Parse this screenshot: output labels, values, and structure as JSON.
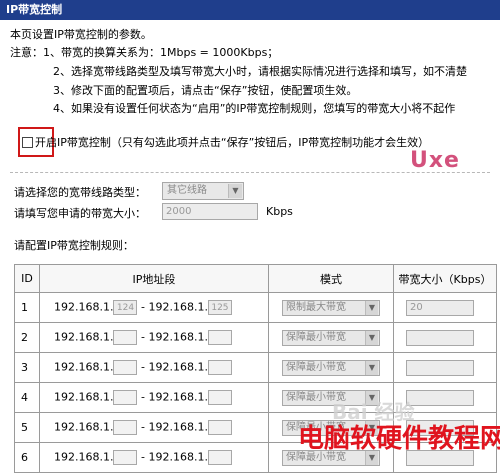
{
  "header": {
    "title": "IP带宽控制"
  },
  "intro": "本页设置IP带宽控制的参数。",
  "notes": [
    "注意：1、带宽的换算关系为：1Mbps = 1000Kbps；",
    "2、选择宽带线路类型及填写带宽大小时，请根据实际情况进行选择和填写，如不清楚",
    "3、修改下面的配置项后，请点击“保存”按钮，使配置项生效。",
    "4、如果没有设置任何状态为“启用”的IP带宽控制规则，您填写的带宽大小将不起作"
  ],
  "enable": {
    "label": "开启IP带宽控制（只有勾选此项并点击“保存”按钮后，IP带宽控制功能才会生效）",
    "checked": false
  },
  "watermark_top": "Uxe",
  "form": {
    "line_type_label": "请选择您的宽带线路类型：",
    "line_type_value": "其它线路",
    "bandwidth_label": "请填写您申请的带宽大小：",
    "bandwidth_value": "2000",
    "bandwidth_unit": "Kbps"
  },
  "rules_title": "请配置IP带宽控制规则：",
  "table": {
    "headers": {
      "id": "ID",
      "ip": "IP地址段",
      "mode": "模式",
      "bandwidth": "带宽大小（Kbps）"
    },
    "ip_prefix": "192.168.1.",
    "ip_sep": "-",
    "rows": [
      {
        "id": "1",
        "start": "124",
        "end": "125",
        "mode": "限制最大带宽",
        "bw": "20"
      },
      {
        "id": "2",
        "start": "",
        "end": "",
        "mode": "保障最小带宽",
        "bw": ""
      },
      {
        "id": "3",
        "start": "",
        "end": "",
        "mode": "保障最小带宽",
        "bw": ""
      },
      {
        "id": "4",
        "start": "",
        "end": "",
        "mode": "保障最小带宽",
        "bw": ""
      },
      {
        "id": "5",
        "start": "",
        "end": "",
        "mode": "保障最小带宽",
        "bw": ""
      },
      {
        "id": "6",
        "start": "",
        "end": "",
        "mode": "保障最小带宽",
        "bw": ""
      }
    ]
  },
  "watermark_bottom": "电脑软硬件教程网",
  "baidu_mark": "Bai 经验"
}
